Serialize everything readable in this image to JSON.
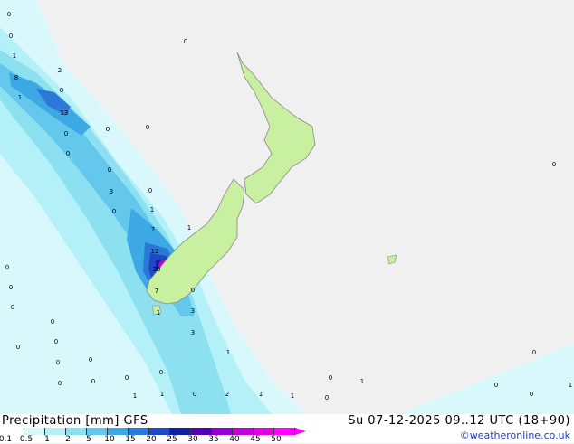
{
  "map": {
    "point_values": [
      "0",
      "0",
      "1",
      "2",
      "8",
      "1",
      "8",
      "13",
      "0",
      "0",
      "0",
      "0",
      "0",
      "0",
      "3",
      "0",
      "1",
      "7",
      "1",
      "12",
      "20",
      "7",
      "0",
      "1",
      "3",
      "3",
      "0",
      "0",
      "0",
      "0",
      "0",
      "0",
      "0",
      "0",
      "0",
      "0",
      "0",
      "0",
      "1",
      "1",
      "2",
      "0",
      "1",
      "1",
      "0",
      "0",
      "1",
      "0",
      "0",
      "0",
      "0",
      "1",
      "0",
      "1"
    ],
    "colors": {
      "background": "#f0f0f0",
      "land": "#c8f0a0",
      "coastline": "#888888",
      "precip_0_1": "#d8f8fc",
      "precip_0_5": "#b4f0f8",
      "precip_1": "#8ce0f0",
      "precip_2": "#64c8ec",
      "precip_5": "#3ca8e4",
      "precip_10": "#2c78d8",
      "precip_15": "#2048c4",
      "precip_20": "#1020a0",
      "precip_25": "#8000d0",
      "precip_30": "#c000d0"
    }
  },
  "footer": {
    "title": "Precipitation [mm]  GFS",
    "datetime": "Su 07-12-2025 09..12 UTC (18+90)",
    "credit": "©weatheronline.co.uk"
  },
  "legend": {
    "levels": [
      "0.1",
      "0.5",
      "1",
      "2",
      "5",
      "10",
      "15",
      "20",
      "25",
      "30",
      "35",
      "40",
      "45",
      "50"
    ],
    "colors": [
      "#ffffff",
      "#d8f8fc",
      "#b4f0f8",
      "#8ce0f0",
      "#64c8ec",
      "#3ca8e4",
      "#2c78d8",
      "#2048c4",
      "#1020a0",
      "#5000b0",
      "#9000d0",
      "#c000d8",
      "#e000e0",
      "#ff00ff"
    ]
  }
}
